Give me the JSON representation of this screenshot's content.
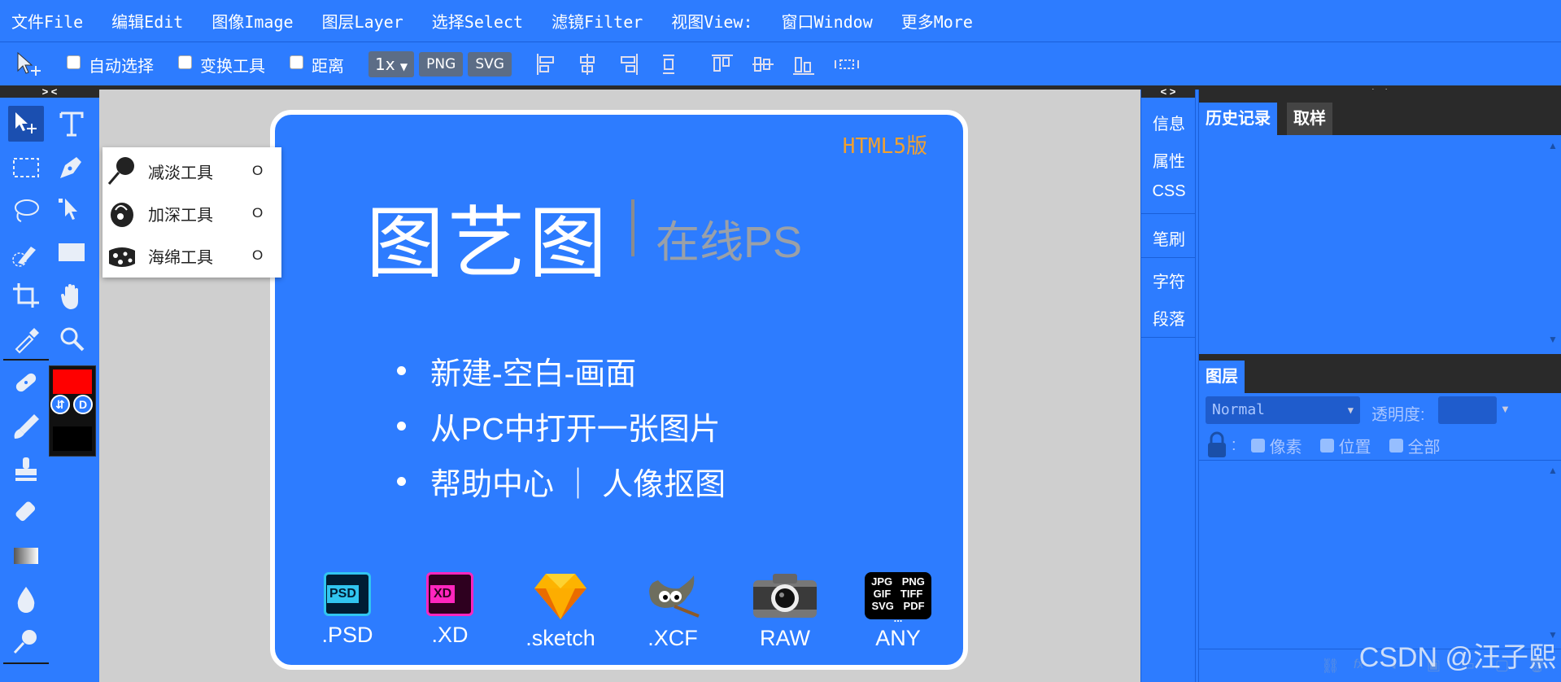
{
  "menu": [
    "文件File",
    "编辑Edit",
    "图像Image",
    "图层Layer",
    "选择Select",
    "滤镜Filter",
    "视图View:",
    "窗口Window",
    "更多More"
  ],
  "options": {
    "auto_select": "自动选择",
    "transform": "变换工具",
    "distance": "距离",
    "zoom": "1x",
    "png": "PNG",
    "svg": "SVG"
  },
  "collapse_left": "> <",
  "collapse_mid": "< >",
  "collapse_right": "> <",
  "popup_items": [
    {
      "label": "减淡工具",
      "shortcut": "O"
    },
    {
      "label": "加深工具",
      "shortcut": "O"
    },
    {
      "label": "海绵工具",
      "shortcut": "O"
    }
  ],
  "colors": {
    "fg": "#ff0000",
    "bg": "#000000",
    "accent": "#2d7cff",
    "html5": "#f0a030"
  },
  "swatch": {
    "swap": "⇵",
    "default": "D"
  },
  "card": {
    "badge": "HTML5版",
    "title": "图艺图",
    "subtitle": "在线PS",
    "links": [
      "新建-空白-画面",
      "从PC中打开一张图片",
      "帮助中心 ｜ 人像抠图"
    ],
    "formats": [
      {
        "icon": "psd-icon",
        "label": ".PSD",
        "glyph": "PSD"
      },
      {
        "icon": "xd-icon",
        "label": ".XD",
        "glyph": "XD"
      },
      {
        "icon": "sketch-icon",
        "label": ".sketch",
        "glyph": ""
      },
      {
        "icon": "gimp-icon",
        "label": ".XCF",
        "glyph": ""
      },
      {
        "icon": "camera-icon",
        "label": "RAW",
        "glyph": ""
      },
      {
        "icon": "any-format-icon",
        "label": "ANY",
        "glyph": "JPG PNG GIF TIFF SVG PDF ..."
      }
    ]
  },
  "side_panels": [
    "信息",
    "属性",
    "CSS",
    "笔刷",
    "字符",
    "段落"
  ],
  "history_tabs": {
    "history": "历史记录",
    "sample": "取样"
  },
  "layers": {
    "tab": "图层",
    "blend_mode": "Normal",
    "opacity_label": "透明度:",
    "lock_sep": ":",
    "lock_pixels": "像素",
    "lock_position": "位置",
    "lock_all": "全部"
  },
  "watermark": "CSDN @汪子熙"
}
